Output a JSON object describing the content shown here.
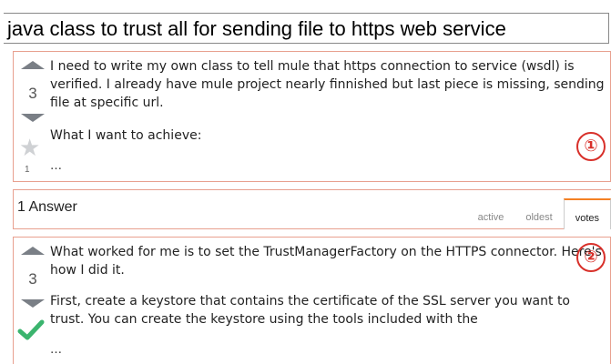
{
  "question": {
    "title": "java class to trust all for sending file to https web service",
    "score": "3",
    "body": [
      "I need to write my own class to tell mule that https connection to service (wsdl) is verified. I already have mule project nearly finnished but last piece is missing, sending file at specific url.",
      "What I want to achieve:"
    ],
    "ellipsis": "…",
    "favorite_count": "1",
    "callout": "①"
  },
  "answers_header": {
    "count_label": "1 Answer",
    "tabs": [
      "active",
      "oldest",
      "votes"
    ],
    "selected_tab": "votes"
  },
  "answer": {
    "score": "3",
    "body": [
      "What worked for me is to set the TrustManagerFactory on the HTTPS connector. Here's how I did it.",
      "First, create a keystore that contains the certificate of the SSL server you want to trust. You can create the keystore using the tools included with the"
    ],
    "ellipsis": "…",
    "callout": "②"
  },
  "colors": {
    "panel_border": "#e8a08f",
    "callout": "#d8302a",
    "accepted_check": "#3bb46e",
    "vote_arrow": "#7a7f86",
    "selected_tab_accent": "#f48024"
  }
}
